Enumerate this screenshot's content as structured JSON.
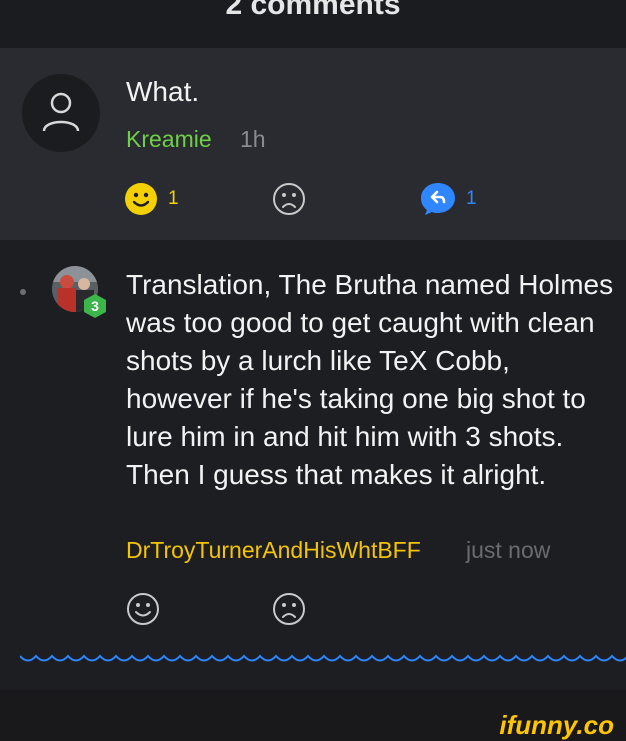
{
  "header": {
    "title": "2 comments"
  },
  "comments": [
    {
      "text": "What.",
      "username": "Kreamie",
      "time": "1h",
      "reactions": {
        "smile_count": "1",
        "reply_count": "1"
      },
      "colors": {
        "username": "#6fcf46",
        "smile": "#f4d000",
        "reply": "#2f86ff"
      }
    },
    {
      "text": "Translation, The Brutha named Holmes was too good to get caught with clean shots by a lurch like TeX Cobb, however if he's taking one big shot to lure him in and hit him with 3 shots. Then I guess that makes it alright.",
      "username": "DrTroyTurnerAndHisWhtBFF",
      "time": "just now",
      "level_badge": "3",
      "colors": {
        "username": "#f4c400",
        "badge": "#3cb54a"
      }
    }
  ],
  "watermark": {
    "text": "ifunny.co",
    "color": "#ffc600"
  },
  "divider": {
    "color": "#2f86ff"
  }
}
